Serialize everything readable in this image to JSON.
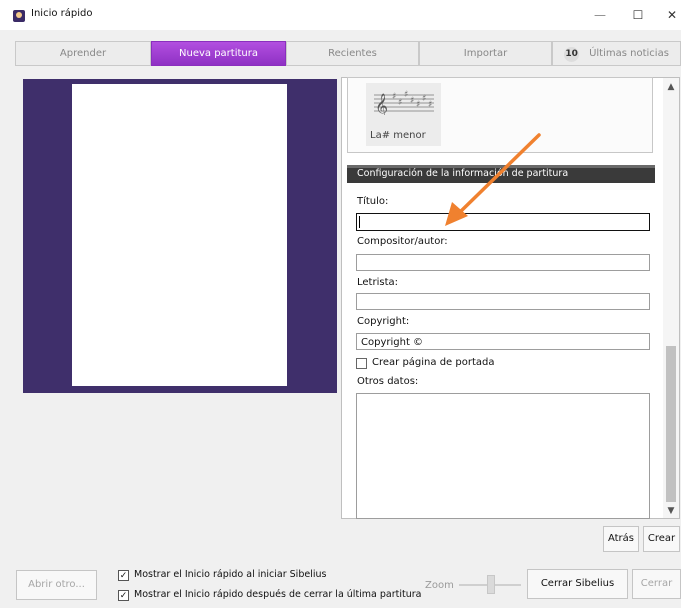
{
  "window": {
    "title": "Inicio rápido",
    "minimize_glyph": "—",
    "maximize_glyph": "☐",
    "close_glyph": "✕"
  },
  "tabs": [
    {
      "label": "Aprender",
      "active": false
    },
    {
      "label": "Nueva partitura",
      "active": true
    },
    {
      "label": "Recientes",
      "active": false
    },
    {
      "label": "Importar",
      "active": false
    },
    {
      "label": "Últimas noticias",
      "count": "10",
      "active": false
    }
  ],
  "key_signature": {
    "label": "La# menor",
    "icon": "key-signature-icon"
  },
  "score_info": {
    "section_title": "Configuración de la información de partitura",
    "title_label": "Título:",
    "title_value": "",
    "composer_label": "Compositor/autor:",
    "composer_value": "",
    "lyricist_label": "Letrista:",
    "lyricist_value": "",
    "copyright_label": "Copyright:",
    "copyright_value": "Copyright ©",
    "cover_page_label": "Crear página de portada",
    "cover_page_checked": false,
    "other_label": "Otros datos:",
    "other_value": ""
  },
  "buttons": {
    "back": "Atrás",
    "create": "Crear",
    "open_other": "Abrir otro...",
    "close_sibelius": "Cerrar Sibelius",
    "close": "Cerrar"
  },
  "options": {
    "show_on_start": "Mostrar el Inicio rápido al iniciar Sibelius",
    "show_on_start_checked": true,
    "show_after_close": "Mostrar el Inicio rápido después de cerrar la última partitura",
    "show_after_close_checked": true
  },
  "zoom": {
    "label": "Zoom"
  },
  "colors": {
    "accent_tab": "#9a38cf",
    "preview_background": "#3f2f6b",
    "annotation_arrow": "#f0812f"
  }
}
